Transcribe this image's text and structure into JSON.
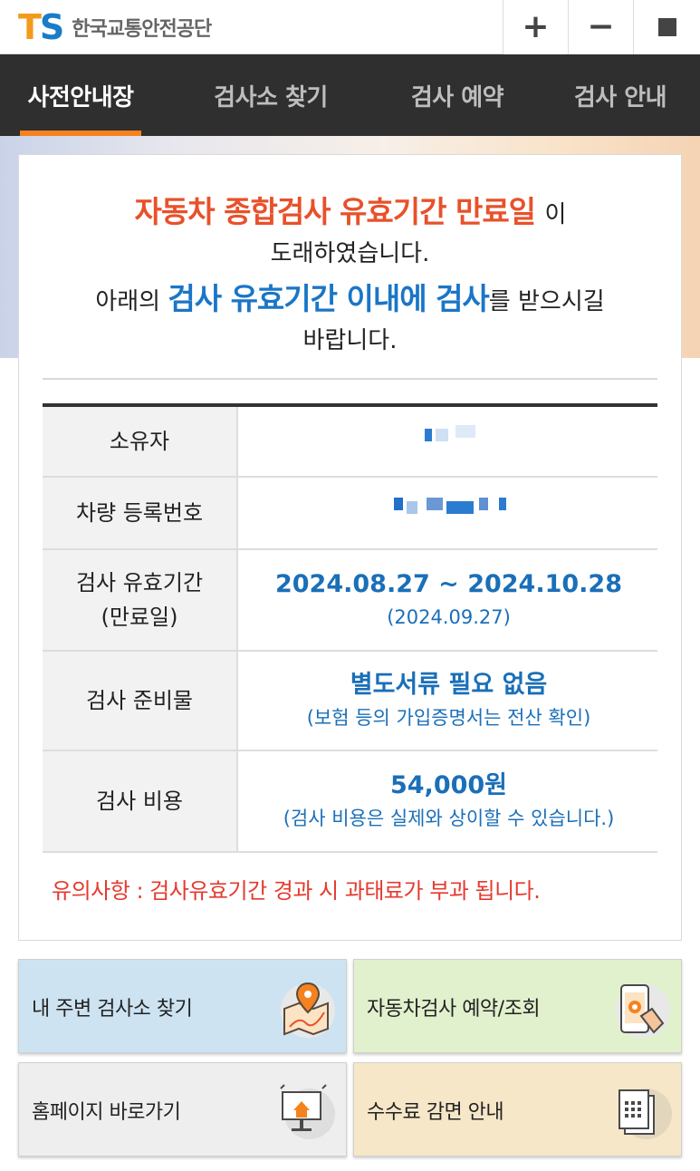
{
  "header": {
    "logo_t": "T",
    "logo_s": "S",
    "org_name": "한국교통안전공단",
    "zoom_in": "+",
    "zoom_out": "−"
  },
  "nav": {
    "tabs": [
      {
        "label": "사전안내장",
        "active": true
      },
      {
        "label": "검사소 찾기",
        "active": false
      },
      {
        "label": "검사 예약",
        "active": false
      },
      {
        "label": "검사 안내",
        "active": false
      }
    ]
  },
  "notice": {
    "highlight1": "자동차 종합검사 유효기간 만료일",
    "tail1": "이",
    "line2": "도래하였습니다.",
    "prefix3": "아래의",
    "highlight3": "검사 유효기간 이내에 검사",
    "suffix3": "를 받으시길",
    "line4": "바랍니다."
  },
  "info": {
    "owner_label": "소유자",
    "plate_label": "차량 등록번호",
    "period_label_1": "검사 유효기간",
    "period_label_2": "(만료일)",
    "period_value": "2024.08.27 ~ 2024.10.28",
    "period_expiry": "(2024.09.27)",
    "prep_label": "검사 준비물",
    "prep_value": "별도서류 필요 없음",
    "prep_note": "(보험 등의 가입증명서는 전산 확인)",
    "cost_label": "검사 비용",
    "cost_value": "54,000원",
    "cost_note": "(검사 비용은 실제와 상이할 수 있습니다.)"
  },
  "caution": "유의사항 : 검사유효기간 경과 시 과태료가 부과 됩니다.",
  "quick_buttons": [
    {
      "label": "내 주변 검사소 찾기",
      "icon": "map-pin-icon",
      "bg": "#cde3f2"
    },
    {
      "label": "자동차검사 예약/조회",
      "icon": "phone-touch-icon",
      "bg": "#e1f1cd"
    },
    {
      "label": "홈페이지 바로가기",
      "icon": "home-monitor-icon",
      "bg": "#eeeeee"
    },
    {
      "label": "수수료 감면 안내",
      "icon": "document-icon",
      "bg": "#f5e7c8"
    }
  ]
}
